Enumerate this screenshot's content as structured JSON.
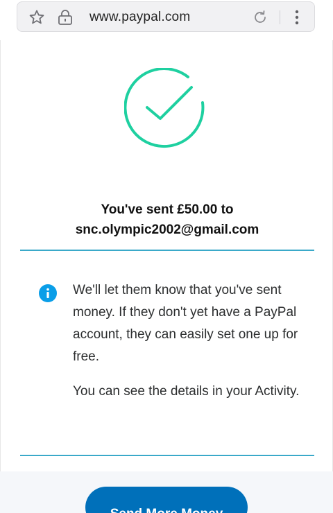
{
  "browser": {
    "url": "www.paypal.com",
    "icons": {
      "bookmark": "star-icon",
      "secure": "lock-icon",
      "reload": "reload-icon",
      "menu": "more-vertical-icon"
    }
  },
  "confirmation": {
    "status_icon": "check-circle-icon",
    "title_line1": "You've sent £50.00 to",
    "title_line2": "snc.olympic2002@gmail.com",
    "amount": "£50.00",
    "recipient": "snc.olympic2002@gmail.com"
  },
  "info": {
    "icon": "info-icon",
    "paragraph1": "We'll let them know that you've sent money. If they don't yet have a PayPal account, they can easily set one up for free.",
    "paragraph2": "You can see the details in your Activity."
  },
  "actions": {
    "send_more_label": "Send More Money"
  },
  "colors": {
    "success_green": "#1ed0a0",
    "divider_blue": "#3aa9c9",
    "info_blue": "#0a9ee8",
    "button_blue": "#0070ba"
  }
}
